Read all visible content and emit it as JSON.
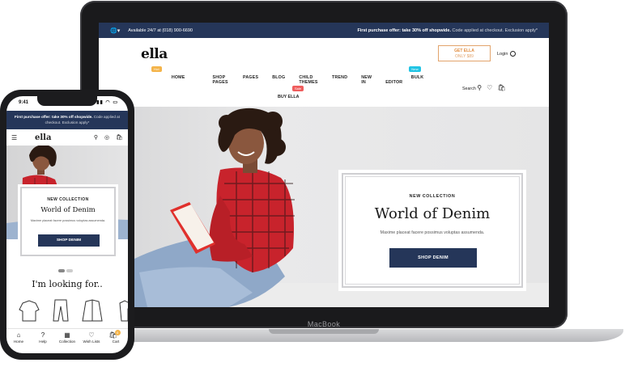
{
  "laptop": {
    "device_label": "MacBook",
    "topbar": {
      "support": "Available 24/7 at (018) 900-6690",
      "promo_bold": "First purchase offer: take 30% off shopwide.",
      "promo_rest": "Code applied at checkout. Exclusion apply*"
    },
    "header": {
      "logo": "ella",
      "get_ella_title": "GET ELLA",
      "get_ella_sub": "ONLY $89",
      "login": "Login",
      "search": "Search"
    },
    "nav": {
      "items": [
        "HOME",
        "SHOP PAGES",
        "PAGES",
        "BLOG",
        "CHILD THEMES",
        "TREND",
        "NEW IN",
        "BULK EDITOR"
      ],
      "second_row": "BUY ELLA",
      "badges": {
        "home": "Hot",
        "bulk_editor": "New",
        "buy_ella": "Sale"
      }
    },
    "hero": {
      "eyebrow": "NEW COLLECTION",
      "title": "World of Denim",
      "text": "Maxime placeat facere possimus voluptas assumenda.",
      "button": "SHOP DENIM"
    }
  },
  "phone": {
    "status_time": "9:41",
    "promo_bold": "First purchase offer: take 30% off shopwide.",
    "promo_rest": "Code applied at checkout. Exclusion apply*",
    "logo": "ella",
    "card": {
      "eyebrow": "NEW COLLECTION",
      "title": "World of Denim",
      "text": "Maxime placeat facere possimus voluptas assumenda.",
      "button": "SHOP DENIM"
    },
    "looking_for": "I'm looking for..",
    "tabbar": [
      {
        "label": "Home",
        "icon": "home-icon"
      },
      {
        "label": "Help",
        "icon": "help-icon"
      },
      {
        "label": "Collection",
        "icon": "grid-icon"
      },
      {
        "label": "Wish Lists",
        "icon": "heart-icon"
      },
      {
        "label": "Cart",
        "icon": "cart-icon"
      }
    ],
    "cart_count": "0"
  },
  "colors": {
    "navy": "#253659",
    "orange": "#e08a3c",
    "hot": "#f4b44a",
    "new": "#21c4e4",
    "sale": "#ef5d5d"
  }
}
